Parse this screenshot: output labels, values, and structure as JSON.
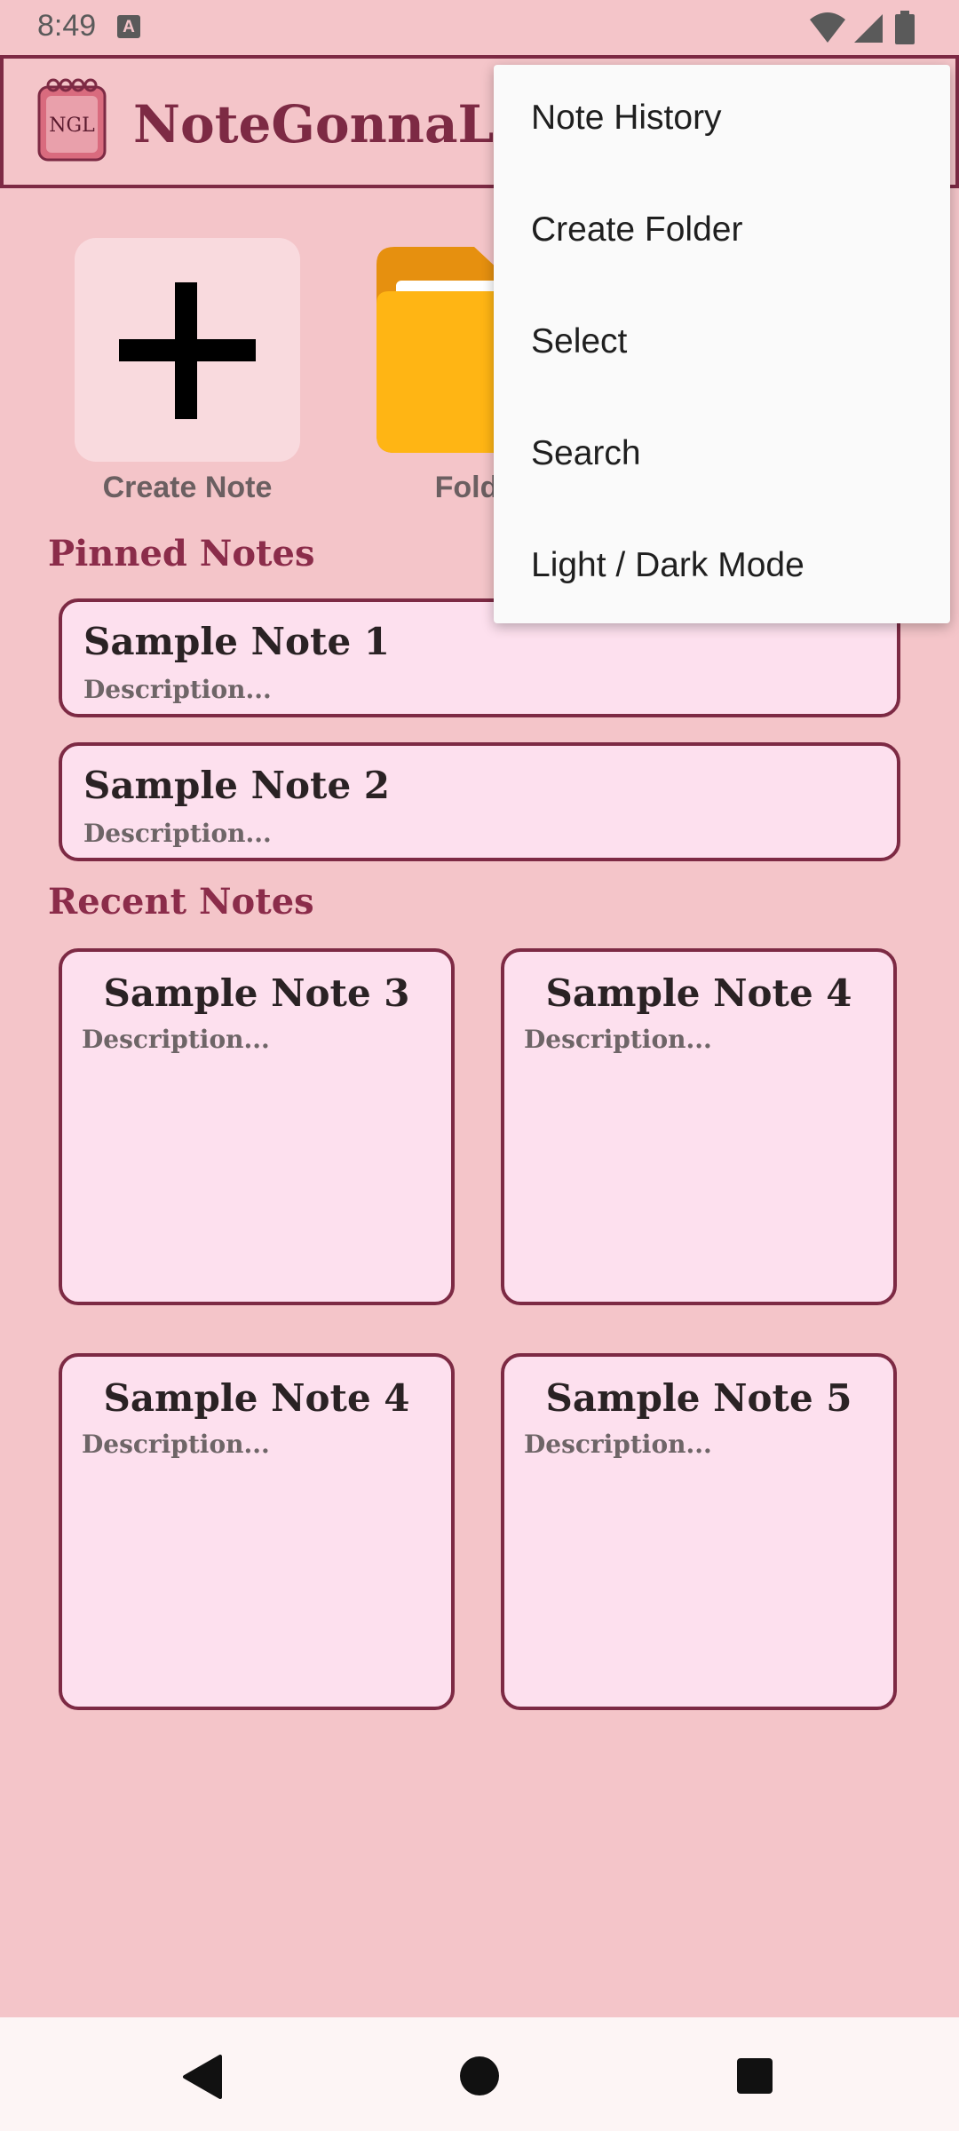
{
  "status_bar": {
    "time": "8:49",
    "notification_badge": "A"
  },
  "app": {
    "title": "NoteGonnaLie",
    "logo_text": "NGL",
    "accent_color": "#7d2a44"
  },
  "actions": {
    "create_note_label": "Create Note",
    "folders_label": "Folders"
  },
  "pinned": {
    "heading": "Pinned Notes",
    "notes": [
      {
        "title": "Sample Note 1",
        "description": "Description..."
      },
      {
        "title": "Sample Note 2",
        "description": "Description..."
      }
    ]
  },
  "recent": {
    "heading": "Recent Notes",
    "notes": [
      {
        "title": "Sample Note 3",
        "description": "Description..."
      },
      {
        "title": "Sample Note 4",
        "description": "Description..."
      },
      {
        "title": "Sample Note 4",
        "description": "Description..."
      },
      {
        "title": "Sample Note 5",
        "description": "Description..."
      }
    ]
  },
  "menu": {
    "items": [
      {
        "label": "Note History"
      },
      {
        "label": "Create Folder"
      },
      {
        "label": "Select"
      },
      {
        "label": "Search"
      },
      {
        "label": "Light / Dark Mode"
      }
    ]
  }
}
